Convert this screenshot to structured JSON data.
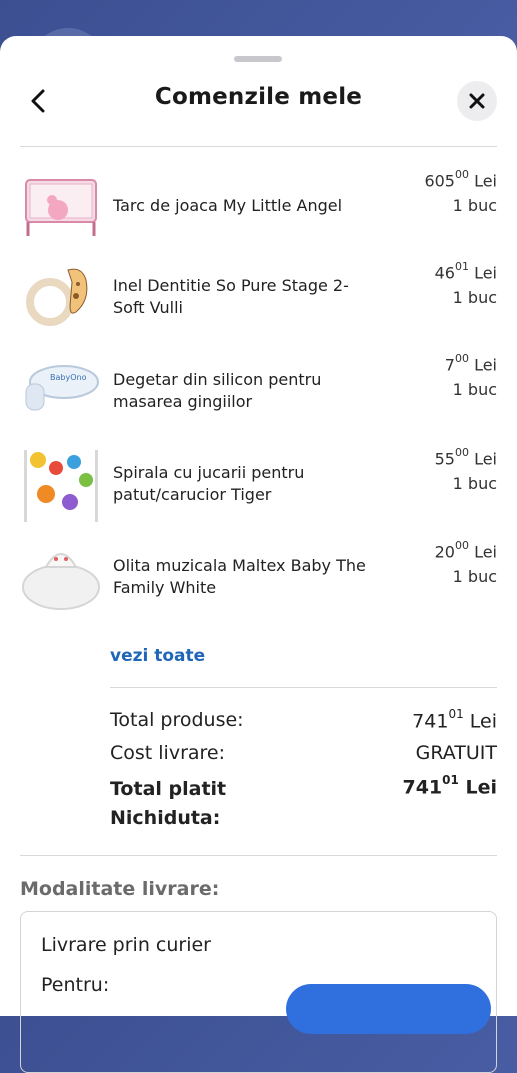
{
  "header": {
    "title": "Comenzile mele"
  },
  "items": [
    {
      "name": "Tarc de joaca My Little Angel",
      "price_int": "605",
      "price_dec": "00",
      "currency": "Lei",
      "qty": "1 buc"
    },
    {
      "name": "Inel Dentitie So Pure Stage 2- Soft Vulli",
      "price_int": "46",
      "price_dec": "01",
      "currency": "Lei",
      "qty": "1 buc"
    },
    {
      "name": "Degetar din silicon pentru masarea gingiilor",
      "price_int": "7",
      "price_dec": "00",
      "currency": "Lei",
      "qty": "1 buc"
    },
    {
      "name": "Spirala cu jucarii pentru patut/carucior Tiger",
      "price_int": "55",
      "price_dec": "00",
      "currency": "Lei",
      "qty": "1 buc"
    },
    {
      "name": "Olita muzicala Maltex Baby The Family White",
      "price_int": "20",
      "price_dec": "00",
      "currency": "Lei",
      "qty": "1 buc"
    }
  ],
  "see_all": "vezi toate",
  "summary": {
    "products_label": "Total produse:",
    "products_int": "741",
    "products_dec": "01",
    "currency": "Lei",
    "shipping_label": "Cost livrare:",
    "shipping_value": "GRATUIT",
    "total_label_1": "Total platit",
    "total_label_2": "Nichiduta:",
    "total_int": "741",
    "total_dec": "01"
  },
  "delivery": {
    "section_title": "Modalitate livrare:",
    "method": "Livrare prin curier",
    "for_label": "Pentru:"
  },
  "icon_names": [
    "chevron-left-icon",
    "close-icon"
  ],
  "colors": {
    "accent_link": "#1f66b8",
    "button": "#2f6fde",
    "header_bg": "#4a5fa6"
  }
}
